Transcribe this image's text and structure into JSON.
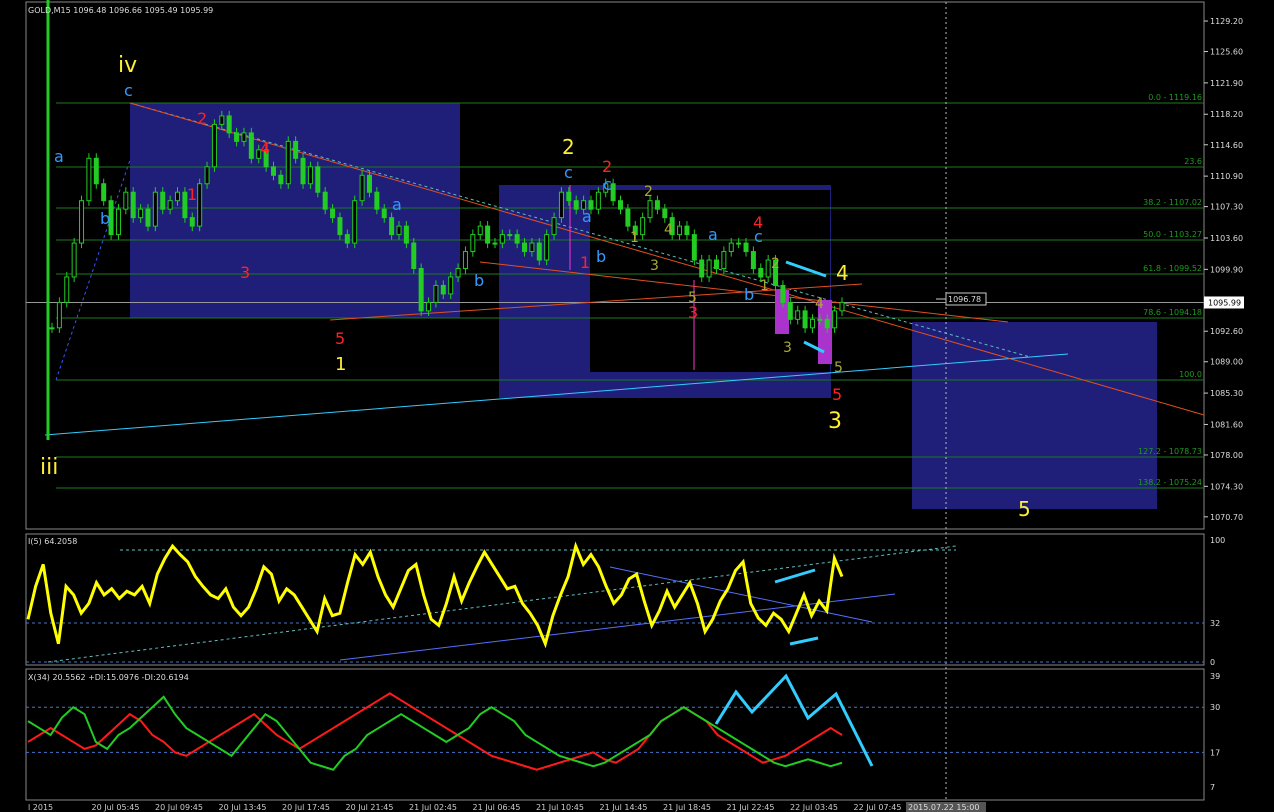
{
  "header": {
    "symbol": "GOLD,M15",
    "ohlc": "1096.48 1096.66 1095.49 1095.99"
  },
  "price_axis": {
    "ticks": [
      "1129.20",
      "1125.60",
      "1121.90",
      "1118.20",
      "1114.60",
      "1110.90",
      "1107.30",
      "1103.60",
      "1099.90",
      "1096.20",
      "1092.60",
      "1089.00",
      "1085.30",
      "1081.60",
      "1078.00",
      "1074.30",
      "1070.70"
    ],
    "current_price": "1095.99",
    "marker_price": "1096.78"
  },
  "fib_levels": [
    "0.0 - 1119.16",
    "23.6",
    "38.2 - 1107.02",
    "50.0 - 1103.27",
    "61.8 - 1099.52",
    "78.6 - 1094.18",
    "100.0",
    "127.2 - 1078.73",
    "138.2 - 1075.24"
  ],
  "wave_labels": {
    "iv": "iv",
    "iii": "iii",
    "a": "a",
    "b": "b",
    "c": "c",
    "one": "1",
    "two": "2",
    "three": "3",
    "four": "4",
    "five": "5"
  },
  "rsi": {
    "title": "I(5) 64.2058",
    "ticks": [
      "100",
      "32",
      "0"
    ]
  },
  "adx": {
    "title": "X(34) 20.5562 +DI:15.0976 -DI:20.6194",
    "ticks": [
      "39",
      "30",
      "17",
      "7"
    ]
  },
  "time_axis": {
    "labels": [
      "l 2015",
      "20 Jul 05:45",
      "20 Jul 09:45",
      "20 Jul 13:45",
      "20 Jul 17:45",
      "20 Jul 21:45",
      "21 Jul 02:45",
      "21 Jul 06:45",
      "21 Jul 10:45",
      "21 Jul 14:45",
      "21 Jul 18:45",
      "21 Jul 22:45",
      "22 Jul 03:45",
      "22 Jul 07:45"
    ],
    "cursor_label": "2015.07.22 15:00"
  },
  "colors": {
    "candle": "#22cc22",
    "box": "#1f1f7a",
    "rsi": "#ffff00",
    "plus_di": "#22cc22",
    "minus_di": "#ff1a1a",
    "cyan": "#33ccff",
    "orange_line": "#e05020"
  },
  "chart_data": {
    "type": "candlestick",
    "title": "GOLD,M15",
    "ylim": [
      1069.5,
      1130.5
    ],
    "series": [
      {
        "name": "GOLD,M15",
        "values": [
          1093,
          1096,
          1099,
          1103,
          1108,
          1113,
          1110,
          1108,
          1104,
          1107,
          1109,
          1106,
          1107,
          1105,
          1109,
          1107,
          1108,
          1109,
          1106,
          1105,
          1110,
          1112,
          1117,
          1118,
          1116,
          1115,
          1116,
          1113,
          1114,
          1112,
          1111,
          1110,
          1115,
          1113,
          1110,
          1112,
          1109,
          1107,
          1106,
          1104,
          1103,
          1108,
          1111,
          1109,
          1107,
          1106,
          1104,
          1105,
          1103,
          1100,
          1095,
          1096,
          1098,
          1097,
          1099,
          1100,
          1102,
          1104,
          1105,
          1103,
          1103,
          1104,
          1104,
          1103,
          1102,
          1103,
          1101,
          1104,
          1106,
          1109,
          1108,
          1107,
          1108,
          1107,
          1109,
          1110,
          1108,
          1107,
          1105,
          1104,
          1106,
          1108,
          1107,
          1106,
          1104,
          1105,
          1104,
          1101,
          1099,
          1101,
          1100,
          1102,
          1103,
          1103,
          1102,
          1100,
          1099,
          1101,
          1098,
          1096,
          1094,
          1095,
          1093,
          1094,
          1094,
          1093,
          1095,
          1096
        ]
      }
    ]
  },
  "rsi_data": {
    "values": [
      35,
      62,
      80,
      40,
      15,
      62,
      55,
      40,
      48,
      65,
      55,
      60,
      52,
      58,
      55,
      62,
      48,
      72,
      85,
      95,
      88,
      82,
      70,
      62,
      55,
      52,
      60,
      45,
      38,
      45,
      60,
      78,
      72,
      50,
      60,
      55,
      45,
      35,
      25,
      52,
      38,
      40,
      65,
      88,
      80,
      90,
      70,
      55,
      45,
      60,
      75,
      80,
      55,
      35,
      30,
      48,
      70,
      50,
      65,
      78,
      90,
      80,
      70,
      60,
      62,
      48,
      40,
      30,
      15,
      38,
      55,
      70,
      95,
      80,
      88,
      78,
      62,
      48,
      55,
      68,
      72,
      50,
      30,
      42,
      58,
      45,
      55,
      65,
      48,
      25,
      35,
      50,
      60,
      75,
      82,
      48,
      36,
      30,
      40,
      35,
      25,
      40,
      55,
      38,
      50,
      42,
      85,
      70
    ]
  },
  "adx_data": {
    "plus_di": [
      26,
      24,
      22,
      27,
      30,
      28,
      20,
      18,
      22,
      24,
      27,
      30,
      33,
      28,
      24,
      22,
      20,
      18,
      16,
      20,
      24,
      28,
      26,
      22,
      18,
      14,
      13,
      12,
      16,
      18,
      22,
      24,
      26,
      28,
      26,
      24,
      22,
      20,
      22,
      24,
      28,
      30,
      28,
      26,
      22,
      20,
      18,
      16,
      15,
      14,
      13,
      14,
      16,
      18,
      20,
      22,
      26,
      28,
      30,
      28,
      26,
      24,
      22,
      20,
      18,
      16,
      14,
      13,
      14,
      15,
      14,
      13,
      14
    ],
    "minus_di": [
      20,
      22,
      24,
      22,
      20,
      18,
      19,
      22,
      25,
      28,
      26,
      22,
      20,
      17,
      16,
      18,
      20,
      22,
      24,
      26,
      28,
      25,
      22,
      20,
      18,
      20,
      22,
      24,
      26,
      28,
      30,
      32,
      34,
      32,
      30,
      28,
      26,
      24,
      22,
      20,
      18,
      16,
      15,
      14,
      13,
      12,
      13,
      14,
      15,
      16,
      17,
      15,
      14,
      16,
      18,
      22,
      26,
      28,
      30,
      28,
      26,
      22,
      20,
      18,
      16,
      14,
      15,
      16,
      18,
      20,
      22,
      24,
      22
    ]
  }
}
